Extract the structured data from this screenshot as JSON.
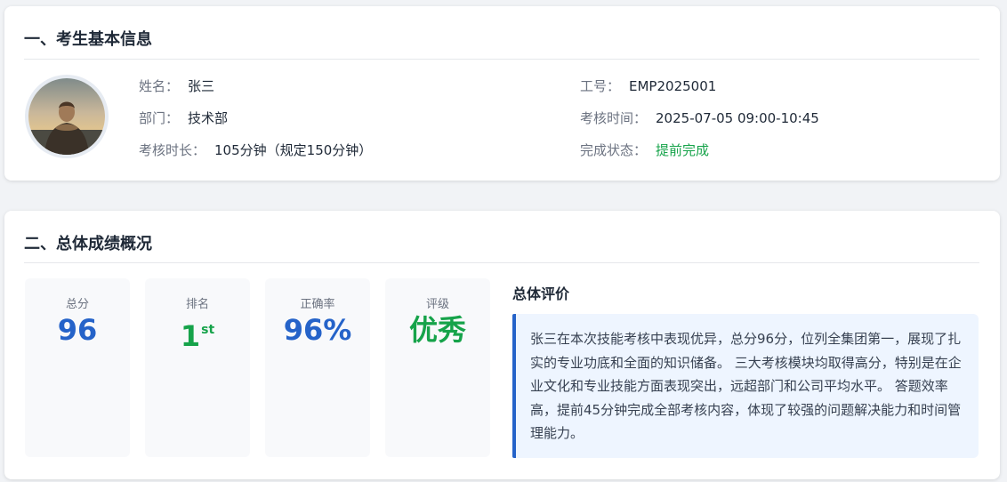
{
  "basic_info": {
    "title": "一、考生基本信息",
    "name_label": "姓名：",
    "name_value": "张三",
    "id_label": "工号：",
    "id_value": "EMP2025001",
    "dept_label": "部门：",
    "dept_value": "技术部",
    "time_label": "考核时间：",
    "time_value": "2025-07-05 09:00-10:45",
    "duration_label": "考核时长：",
    "duration_value": "105分钟（规定150分钟）",
    "status_label": "完成状态：",
    "status_value": "提前完成",
    "status_color": "#16a34a"
  },
  "overview": {
    "title": "二、总体成绩概况",
    "stats": [
      {
        "label": "总分",
        "value": "96",
        "color": "#2563c9"
      },
      {
        "label": "排名",
        "value": "1",
        "suffix": "st",
        "color": "#16a34a"
      },
      {
        "label": "正确率",
        "value": "96%",
        "color": "#2563c9"
      },
      {
        "label": "评级",
        "value": "优秀",
        "color": "#16a34a"
      }
    ],
    "evaluation_title": "总体评价",
    "evaluation_text": "张三在本次技能考核中表现优异，总分96分，位列全集团第一，展现了扎实的专业功底和全面的知识储备。 三大考核模块均取得高分，特别是在企业文化和专业技能方面表现突出，远超部门和公司平均水平。 答题效率高，提前45分钟完成全部考核内容，体现了较强的问题解决能力和时间管理能力。"
  },
  "colors": {
    "accent_blue": "#2563c9",
    "accent_green": "#16a34a",
    "eval_bg": "#eef5ff"
  },
  "icons": {
    "avatar": "user-photo"
  }
}
